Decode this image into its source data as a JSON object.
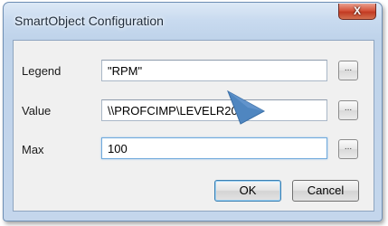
{
  "window": {
    "title": "SmartObject Configuration",
    "close_label": "X"
  },
  "fields": {
    "legend": {
      "label": "Legend",
      "value": "\"RPM\"",
      "browse_label": "..."
    },
    "value": {
      "label": "Value",
      "value": "\\\\PROFCIMP\\LEVELR201",
      "browse_label": "..."
    },
    "max": {
      "label": "Max",
      "value": "100",
      "browse_label": "..."
    }
  },
  "buttons": {
    "ok_label": "OK",
    "cancel_label": "Cancel"
  },
  "colors": {
    "title_bar": "#c8daef",
    "close_button": "#c23a22",
    "focus_border": "#6fa9dc",
    "pointer": "#4f86c0"
  },
  "pointer_icon": "pointer-arrow-icon"
}
